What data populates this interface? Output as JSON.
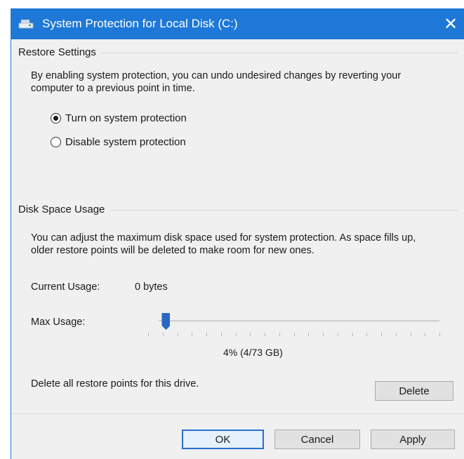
{
  "window": {
    "title": "System Protection for Local Disk (C:)",
    "close_glyph": "✕",
    "accent_color": "#1e78d7"
  },
  "restore_settings": {
    "heading": "Restore Settings",
    "description": "By enabling system protection, you can undo undesired changes by reverting your computer to a previous point in time.",
    "options": [
      {
        "label": "Turn on system protection",
        "checked": true
      },
      {
        "label": "Disable system protection",
        "checked": false
      }
    ]
  },
  "disk_space": {
    "heading": "Disk Space Usage",
    "description": "You can adjust the maximum disk space used for system protection. As space fills up, older restore points will be deleted to make room for new ones.",
    "current_usage_label": "Current Usage:",
    "current_usage_value": "0 bytes",
    "max_usage_label": "Max Usage:",
    "max_usage_percent": 4,
    "max_usage_readout": "4% (4/73 GB)",
    "delete_description": "Delete all restore points for this drive.",
    "delete_button": "Delete"
  },
  "footer": {
    "ok_label": "OK",
    "cancel_label": "Cancel",
    "apply_label": "Apply"
  }
}
